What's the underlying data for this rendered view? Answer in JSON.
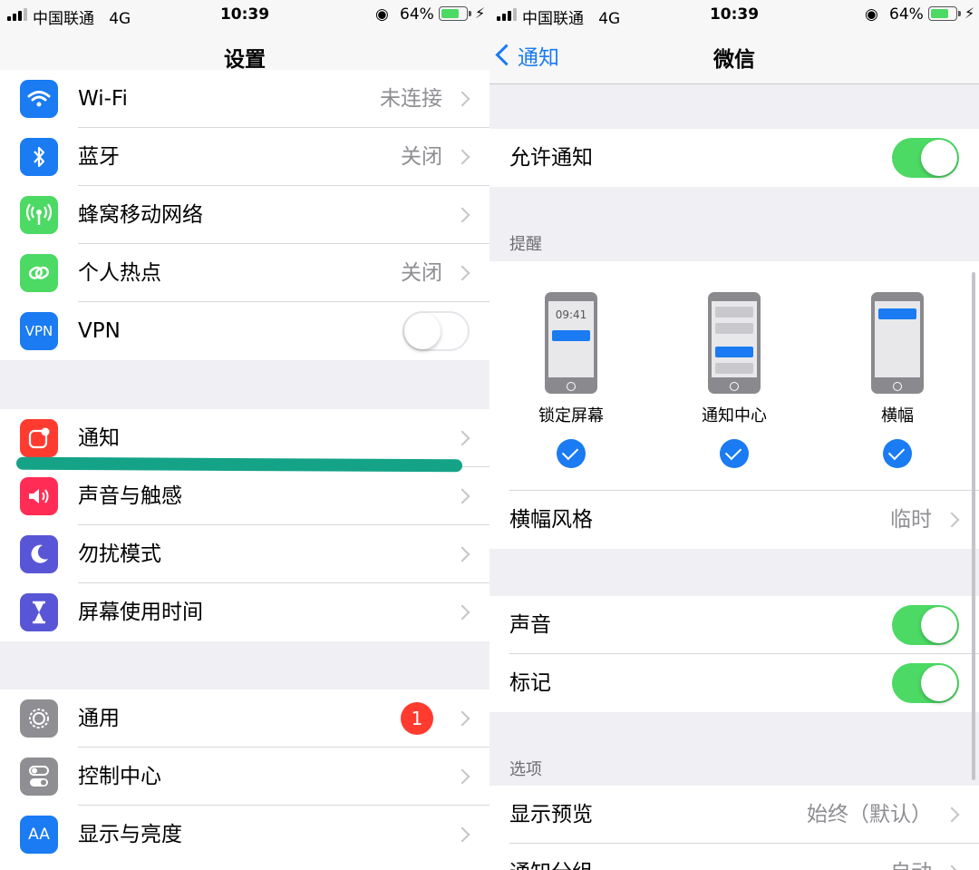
{
  "status": {
    "carrier": "中国联通",
    "network": "4G",
    "time": "10:39",
    "battery": "64%"
  },
  "left": {
    "title": "设置",
    "group1": [
      {
        "label": "Wi-Fi",
        "value": "未连接",
        "icon": "wifi-icon",
        "color": "#1a7bf2"
      },
      {
        "label": "蓝牙",
        "value": "关闭",
        "icon": "bluetooth-icon",
        "color": "#1a7bf2"
      },
      {
        "label": "蜂窝移动网络",
        "value": "",
        "icon": "cellular-icon",
        "color": "#4cd964"
      },
      {
        "label": "个人热点",
        "value": "关闭",
        "icon": "hotspot-icon",
        "color": "#4cd964"
      },
      {
        "label": "VPN",
        "icon": "vpn-icon",
        "icon_text": "VPN",
        "color": "#1a7bf2",
        "toggle": false
      }
    ],
    "group2": [
      {
        "label": "通知",
        "icon": "notifications-icon",
        "color": "#ff3b30"
      },
      {
        "label": "声音与触感",
        "icon": "sound-icon",
        "color": "#ff2d55"
      },
      {
        "label": "勿扰模式",
        "icon": "moon-icon",
        "color": "#5856d6"
      },
      {
        "label": "屏幕使用时间",
        "icon": "hourglass-icon",
        "color": "#5856d6"
      }
    ],
    "group3": [
      {
        "label": "通用",
        "icon": "gear-icon",
        "color": "#8e8e93",
        "badge": "1"
      },
      {
        "label": "控制中心",
        "icon": "control-center-icon",
        "color": "#8e8e93"
      },
      {
        "label": "显示与亮度",
        "icon": "display-icon",
        "icon_text": "AA",
        "color": "#1a7bf2"
      }
    ]
  },
  "right": {
    "back_label": "通知",
    "title": "微信",
    "allow_label": "允许通知",
    "alerts_header": "提醒",
    "styles": [
      {
        "label": "锁定屏幕",
        "time": "09:41",
        "checked": true
      },
      {
        "label": "通知中心",
        "checked": true
      },
      {
        "label": "横幅",
        "checked": true
      }
    ],
    "banner_style_label": "横幅风格",
    "banner_style_value": "临时",
    "sound_label": "声音",
    "badge_label": "标记",
    "options_header": "选项",
    "preview_label": "显示预览",
    "preview_value": "始终（默认）",
    "grouping_label": "通知分组",
    "grouping_value": "自动"
  }
}
